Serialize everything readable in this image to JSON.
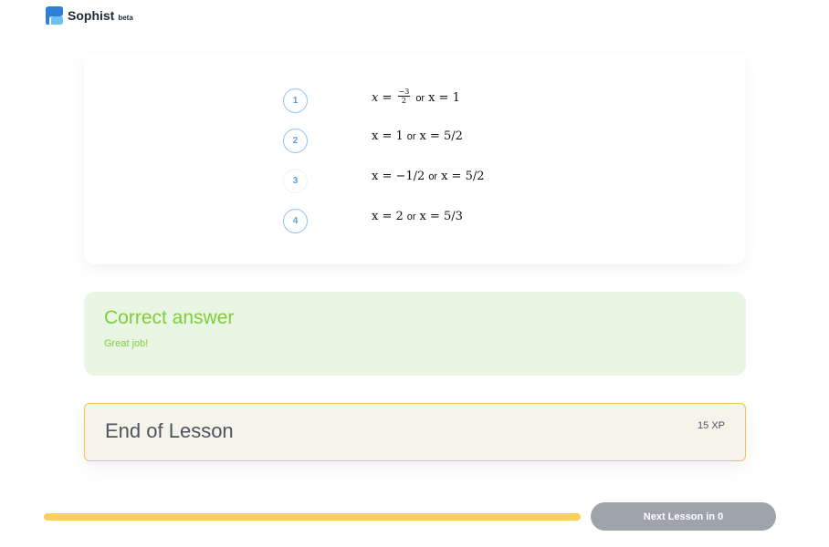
{
  "header": {
    "brand": "Sophist",
    "badge": "beta",
    "logo_icon": "sophist-logo-icon"
  },
  "question": {
    "options": [
      {
        "number": "1",
        "answer_a": "x = -3/2",
        "or": "or",
        "answer_b": "x = 1"
      },
      {
        "number": "2",
        "answer_a": "x = 1",
        "or": "or",
        "answer_b": "x = 5/2"
      },
      {
        "number": "3",
        "answer_a": "x = −1/2",
        "or": "or",
        "answer_b": "x = 5/2",
        "selected": true
      },
      {
        "number": "4",
        "answer_a": "x = 2",
        "or": "or",
        "answer_b": "x = 5/3"
      }
    ]
  },
  "result": {
    "title": "Correct answer",
    "subtitle": "Great job!",
    "color": "#7fcc3c"
  },
  "end": {
    "title": "End of Lesson",
    "xp": "15 XP",
    "border_color": "#f5c15a"
  },
  "footer": {
    "progress_fraction": 1.0,
    "progress_color": "#fbd056",
    "next_label": "Next Lesson in 0"
  }
}
